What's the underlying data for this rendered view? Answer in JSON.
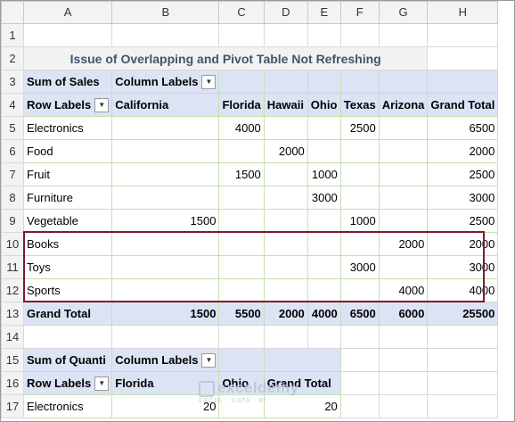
{
  "columns": [
    "A",
    "B",
    "C",
    "D",
    "E",
    "F",
    "G",
    "H"
  ],
  "rows": [
    "1",
    "2",
    "3",
    "4",
    "5",
    "6",
    "7",
    "8",
    "9",
    "10",
    "11",
    "12",
    "13",
    "14",
    "15",
    "16",
    "17"
  ],
  "title": "Issue of Overlapping and Pivot Table Not Refreshing",
  "pivot1": {
    "value_label": "Sum of Sales",
    "column_labels": "Column Labels",
    "row_labels": "Row Labels",
    "headers": [
      "California",
      "Florida",
      "Hawaii",
      "Ohio",
      "Texas",
      "Arizona",
      "Grand Total"
    ],
    "rows": [
      {
        "label": "Electronics",
        "cells": [
          "",
          "4000",
          "",
          "",
          "2500",
          "",
          "6500"
        ]
      },
      {
        "label": "Food",
        "cells": [
          "",
          "",
          "2000",
          "",
          "",
          "",
          "2000"
        ]
      },
      {
        "label": "Fruit",
        "cells": [
          "",
          "1500",
          "",
          "1000",
          "",
          "",
          "2500"
        ]
      },
      {
        "label": "Furniture",
        "cells": [
          "",
          "",
          "",
          "3000",
          "",
          "",
          "3000"
        ]
      },
      {
        "label": "Vegetable",
        "cells": [
          "1500",
          "",
          "",
          "",
          "1000",
          "",
          "2500"
        ]
      },
      {
        "label": "Books",
        "cells": [
          "",
          "",
          "",
          "",
          "",
          "2000",
          "2000"
        ]
      },
      {
        "label": "Toys",
        "cells": [
          "",
          "",
          "",
          "",
          "3000",
          "",
          "3000"
        ]
      },
      {
        "label": "Sports",
        "cells": [
          "",
          "",
          "",
          "",
          "",
          "4000",
          "4000"
        ]
      }
    ],
    "grand_total": {
      "label": "Grand Total",
      "cells": [
        "1500",
        "5500",
        "2000",
        "4000",
        "6500",
        "6000",
        "25500"
      ]
    }
  },
  "pivot2": {
    "value_label": "Sum of Quanti",
    "column_labels": "Column Labels",
    "row_labels": "Row Labels",
    "headers": [
      "Florida",
      "Ohio",
      "Grand Total"
    ],
    "rows": [
      {
        "label": "Electronics",
        "cells": [
          "20",
          "",
          "20"
        ]
      }
    ]
  },
  "dropdown_glyph": "▼",
  "watermark": {
    "main": "exceldemy",
    "sub": "EXCEL · DATA · BI"
  },
  "colors": {
    "highlight_border": "#7b1c2a",
    "pivot_header": "#dce3f5",
    "title_text": "#44546a"
  }
}
